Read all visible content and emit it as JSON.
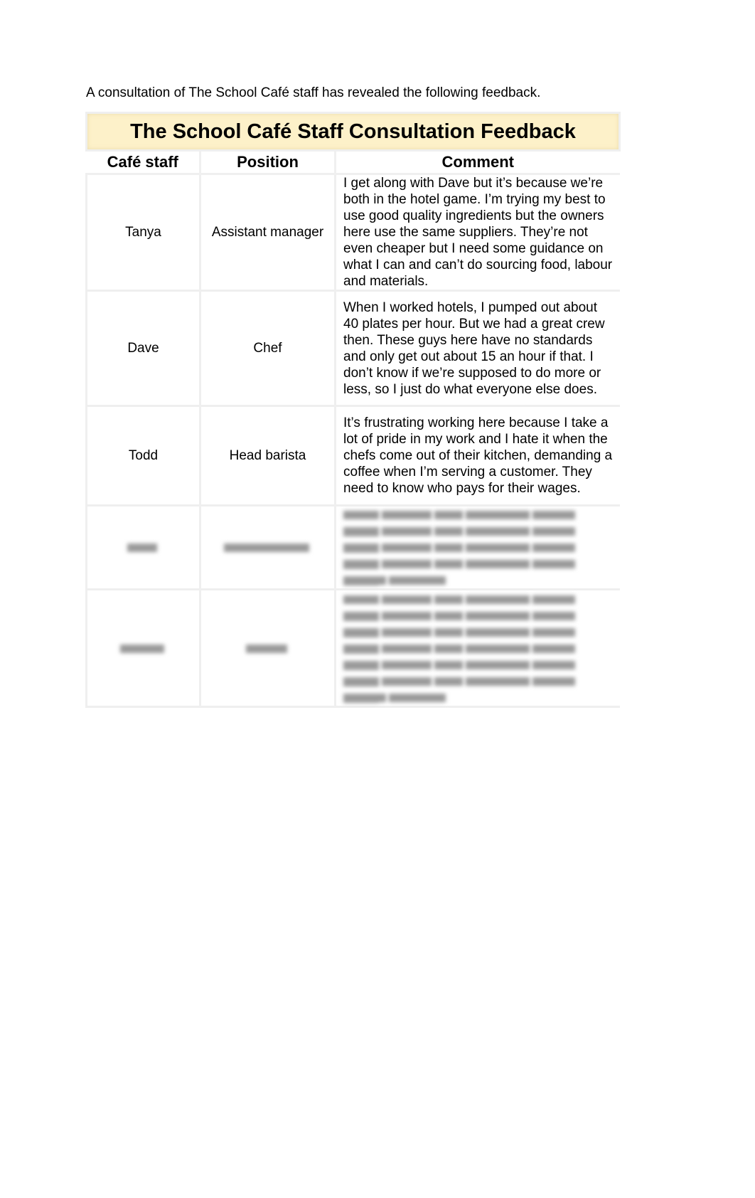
{
  "intro": "A consultation of The School Café staff has revealed the following feedback.",
  "table": {
    "title": "The School Café Staff Consultation Feedback",
    "headers": [
      "Café staff",
      "Position",
      "Comment"
    ],
    "rows": [
      {
        "name": "Tanya",
        "position": "Assistant manager",
        "comment": "I get along with Dave but it’s because we’re both in the hotel game. I’m trying my best to use good quality ingredients but the owners here use the same suppliers. They’re not even cheaper but I need some guidance on what I can and can’t do sourcing food, labour and materials."
      },
      {
        "name": "Dave",
        "position": "Chef",
        "comment": "When I worked hotels, I pumped out about 40 plates per hour. But we had a great crew then. These guys here have no standards and only get out about 15 an hour if that. I don’t know if we’re supposed to do more or less, so I just do what everyone else does."
      },
      {
        "name": "Todd",
        "position": "Head barista",
        "comment": "It’s frustrating working here because I take a lot of pride in my work and I hate it when the chefs come out of their kitchen, demanding a coffee when I’m serving a customer. They need to know who pays for their wages."
      },
      {
        "name": "[obscured]",
        "position": "[obscured]",
        "comment": "[obscured]",
        "obscured": true,
        "comment_lines": 5
      },
      {
        "name": "[obscured]",
        "position": "[obscured]",
        "comment": "[obscured]",
        "obscured": true,
        "comment_lines": 7
      }
    ]
  }
}
